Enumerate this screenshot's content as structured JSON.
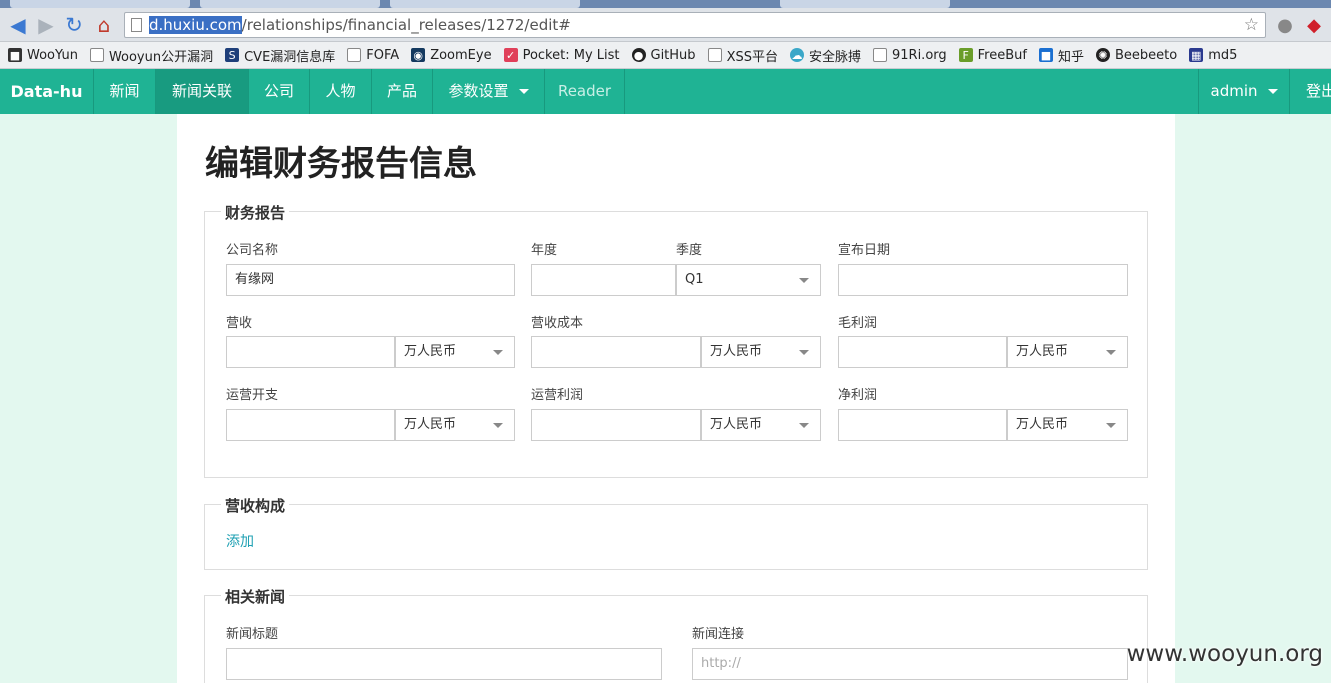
{
  "browser": {
    "url_host": "d.huxiu.com",
    "url_path": "/relationships/financial_releases/1272/edit#",
    "bookmarks": [
      "WooYun",
      "Wooyun公开漏洞",
      "CVE漏洞信息库",
      "FOFA",
      "ZoomEye",
      "Pocket: My List",
      "GitHub",
      "XSS平台",
      "安全脉搏",
      "91Ri.org",
      "FreeBuf",
      "知乎",
      "Beebeeto",
      "md5"
    ]
  },
  "nav": {
    "brand": "Data-hu",
    "news": "新闻",
    "news_relations": "新闻关联",
    "company": "公司",
    "people": "人物",
    "product": "产品",
    "params": "参数设置",
    "reader": "Reader",
    "user": "admin",
    "logout": "登出"
  },
  "page": {
    "title": "编辑财务报告信息"
  },
  "financial": {
    "legend": "财务报告",
    "company_label": "公司名称",
    "company_value": "有缘网",
    "year_label": "年度",
    "year_value": "",
    "quarter_label": "季度",
    "quarter_value": "Q1",
    "date_label": "宣布日期",
    "revenue_label": "营收",
    "cost_label": "营收成本",
    "gross_label": "毛利润",
    "opex_label": "运营开支",
    "opprofit_label": "运营利润",
    "net_label": "净利润",
    "currency": "万人民币"
  },
  "composition": {
    "legend": "营收构成",
    "add": "添加"
  },
  "related_news": {
    "legend": "相关新闻",
    "title_label": "新闻标题",
    "link_label": "新闻连接",
    "link_placeholder": "http://"
  },
  "watermark": "www.wooyun.org"
}
